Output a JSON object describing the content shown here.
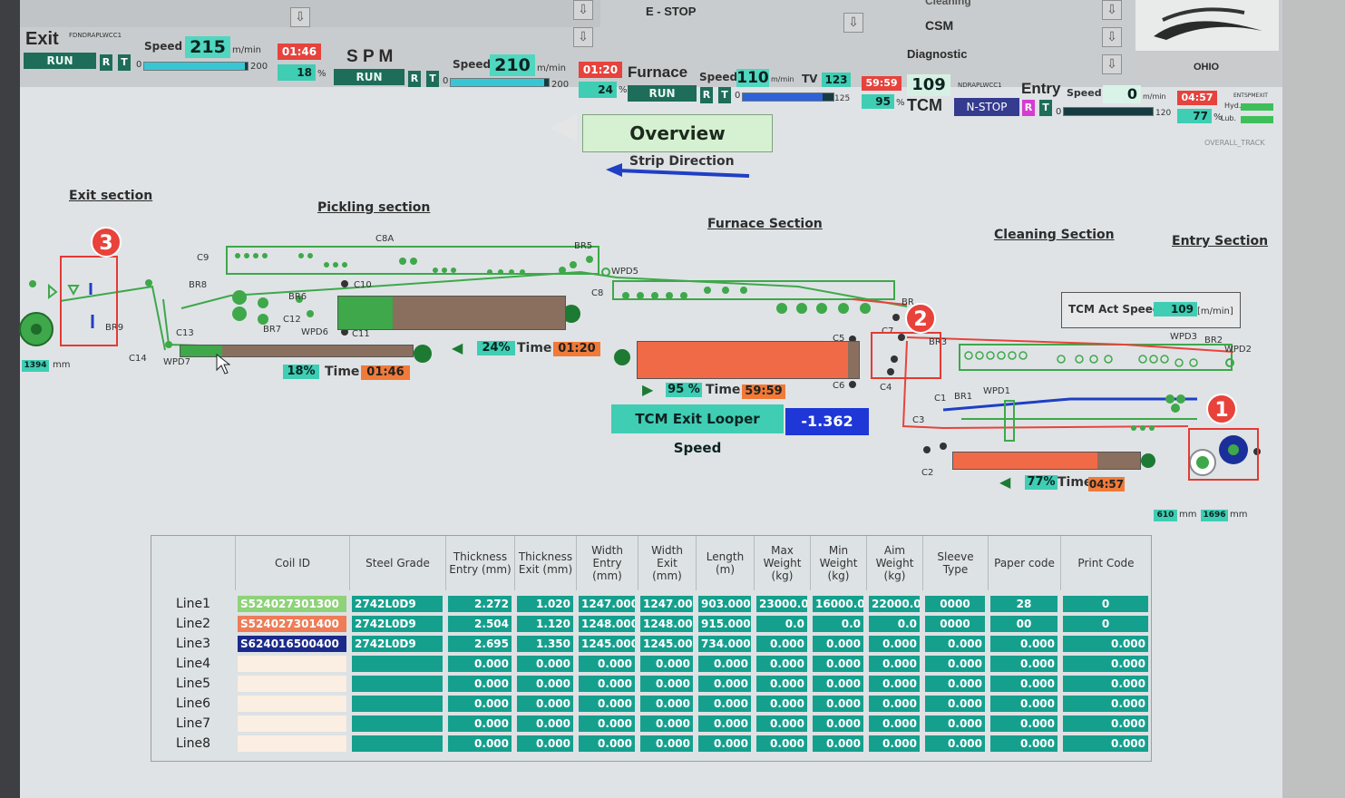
{
  "header": {
    "estop_label": "E - STOP",
    "csm_label": "CSM",
    "diagnostic_label": "Diagnostic",
    "cleaning_label": "Cleaning",
    "logo_text": "OHIO"
  },
  "processes": {
    "exit": {
      "name": "Exit",
      "code": "FDNDRAPLWCC1",
      "speed_label": "Speed",
      "speed": "215",
      "unit": "m/min",
      "status": "RUN",
      "r": "R",
      "t": "T",
      "bar_min": "0",
      "bar_max": "200",
      "bar_pct": 0.97,
      "time": "01:46",
      "pct": "18",
      "pct_sign": "%"
    },
    "spm": {
      "name": "S P M",
      "speed_label": "Speed",
      "speed": "210",
      "unit": "m/min",
      "status": "RUN",
      "r": "R",
      "t": "T",
      "bar_min": "0",
      "bar_max": "200",
      "bar_pct": 0.95,
      "time": "01:20",
      "pct": "24",
      "pct_sign": "%"
    },
    "furnace": {
      "name": "Furnace",
      "speed_label": "Speed",
      "speed": "110",
      "unit": "m/min",
      "tv_label": "TV",
      "tv": "123",
      "status": "RUN",
      "r": "R",
      "t": "T",
      "bar_min": "0",
      "bar_max": "125",
      "bar_pct": 0.88,
      "time": "59:59",
      "pct": "95",
      "pct_sign": "%"
    },
    "tcm": {
      "name": "TCM",
      "speed": "109",
      "code": "NDRAPLWCC1",
      "status": "N-STOP",
      "r": "R",
      "t": "T"
    },
    "entry": {
      "name": "Entry",
      "speed_label": "Speed",
      "speed": "0",
      "unit": "m/min",
      "bar_min": "0",
      "bar_max": "120",
      "bar_pct": 0.0,
      "time": "04:57",
      "pct": "77",
      "pct_sign": "%",
      "panel_title": "ENTSPMEXIT",
      "hyd": "Hyd.",
      "lub": "Lub."
    }
  },
  "overview": {
    "title": "Overview",
    "strip_direction": "Strip Direction",
    "overall_track": "OVERALL_TRACK"
  },
  "sections": {
    "exit": "Exit section",
    "pickling": "Pickling section",
    "furnace": "Furnace Section",
    "cleaning": "Cleaning Section",
    "entry": "Entry Section"
  },
  "equipment": {
    "c9": "C9",
    "c8a": "C8A",
    "br5": "BR5",
    "wpd5": "WPD5",
    "br8": "BR8",
    "c10": "C10",
    "br6": "BR6",
    "c12": "C12",
    "br7": "BR7",
    "wpd6": "WPD6",
    "c11": "C11",
    "c13": "C13",
    "br9": "BR9",
    "c14": "C14",
    "wpd7": "WPD7",
    "c8": "C8",
    "c5": "C5",
    "c6": "C6",
    "c4": "C4",
    "br4": "BR",
    "c7": "C7",
    "br3": "BR3",
    "c1": "C1",
    "br1": "BR1",
    "wpd1": "WPD1",
    "c3": "C3",
    "c2": "C2",
    "wpd3": "WPD3",
    "br2": "BR2",
    "wpd2": "WPD2"
  },
  "loopers": {
    "exit": {
      "pct": "18%",
      "time_label": "Time",
      "time": "01:46",
      "fill": 0.18
    },
    "spm": {
      "pct": "24%",
      "time_label": "Time",
      "time": "01:20",
      "fill": 0.24
    },
    "furnace": {
      "pct": "95 %",
      "time_label": "Time",
      "time": "59:59",
      "fill": 0.95
    },
    "entry": {
      "pct": "77%",
      "time_label": "Time",
      "time": "04:57",
      "fill": 0.77
    }
  },
  "coil_sizes": {
    "exit_coil": "1394",
    "exit_unit": "mm",
    "entry_a": "610",
    "entry_a_unit": "mm",
    "entry_b": "1696",
    "entry_b_unit": "mm"
  },
  "tcm_act": {
    "label": "TCM Act Speed",
    "value": "109",
    "unit": "[m/min]"
  },
  "tcm_exit_looper": {
    "label": "TCM Exit Looper Speed",
    "value": "-1.362"
  },
  "markers": [
    "1",
    "2",
    "3"
  ],
  "table": {
    "headers": [
      "Coil ID",
      "Steel Grade",
      "Thickness Entry (mm)",
      "Thickness Exit (mm)",
      "Width Entry (mm)",
      "Width Exit (mm)",
      "Length (m)",
      "Max Weight (kg)",
      "Min Weight (kg)",
      "Aim Weight (kg)",
      "Sleeve Type",
      "Paper code",
      "Print Code"
    ],
    "rows": [
      {
        "line": "Line1",
        "coil_id": "S524027301300",
        "id_color": "#8ed27a",
        "grade": "2742L0D9",
        "thk_entry": "2.272",
        "thk_exit": "1.020",
        "w_entry": "1247.000",
        "w_exit": "1247.000",
        "length": "903.000",
        "max_w": "23000.0",
        "min_w": "16000.0",
        "aim_w": "22000.0",
        "sleeve": "0000",
        "paper": "28",
        "print": "0"
      },
      {
        "line": "Line2",
        "coil_id": "S524027301400",
        "id_color": "#ee7c57",
        "grade": "2742L0D9",
        "thk_entry": "2.504",
        "thk_exit": "1.120",
        "w_entry": "1248.000",
        "w_exit": "1248.000",
        "length": "915.000",
        "max_w": "0.0",
        "min_w": "0.0",
        "aim_w": "0.0",
        "sleeve": "0000",
        "paper": "00",
        "print": "0"
      },
      {
        "line": "Line3",
        "coil_id": "S624016500400",
        "id_color": "#1b2a8a",
        "grade": "2742L0D9",
        "thk_entry": "2.695",
        "thk_exit": "1.350",
        "w_entry": "1245.000",
        "w_exit": "1245.000",
        "length": "734.000",
        "max_w": "0.000",
        "min_w": "0.000",
        "aim_w": "0.000",
        "sleeve": "0.000",
        "paper": "0.000",
        "print": "0.000"
      },
      {
        "line": "Line4",
        "coil_id": "",
        "id_color": "#fbeee2",
        "grade": "",
        "thk_entry": "0.000",
        "thk_exit": "0.000",
        "w_entry": "0.000",
        "w_exit": "0.000",
        "length": "0.000",
        "max_w": "0.000",
        "min_w": "0.000",
        "aim_w": "0.000",
        "sleeve": "0.000",
        "paper": "0.000",
        "print": "0.000"
      },
      {
        "line": "Line5",
        "coil_id": "",
        "id_color": "#fbeee2",
        "grade": "",
        "thk_entry": "0.000",
        "thk_exit": "0.000",
        "w_entry": "0.000",
        "w_exit": "0.000",
        "length": "0.000",
        "max_w": "0.000",
        "min_w": "0.000",
        "aim_w": "0.000",
        "sleeve": "0.000",
        "paper": "0.000",
        "print": "0.000"
      },
      {
        "line": "Line6",
        "coil_id": "",
        "id_color": "#fbeee2",
        "grade": "",
        "thk_entry": "0.000",
        "thk_exit": "0.000",
        "w_entry": "0.000",
        "w_exit": "0.000",
        "length": "0.000",
        "max_w": "0.000",
        "min_w": "0.000",
        "aim_w": "0.000",
        "sleeve": "0.000",
        "paper": "0.000",
        "print": "0.000"
      },
      {
        "line": "Line7",
        "coil_id": "",
        "id_color": "#fbeee2",
        "grade": "",
        "thk_entry": "0.000",
        "thk_exit": "0.000",
        "w_entry": "0.000",
        "w_exit": "0.000",
        "length": "0.000",
        "max_w": "0.000",
        "min_w": "0.000",
        "aim_w": "0.000",
        "sleeve": "0.000",
        "paper": "0.000",
        "print": "0.000"
      },
      {
        "line": "Line8",
        "coil_id": "",
        "id_color": "#fbeee2",
        "grade": "",
        "thk_entry": "0.000",
        "thk_exit": "0.000",
        "w_entry": "0.000",
        "w_exit": "0.000",
        "length": "0.000",
        "max_w": "0.000",
        "min_w": "0.000",
        "aim_w": "0.000",
        "sleeve": "0.000",
        "paper": "0.000",
        "print": "0.000"
      }
    ]
  },
  "colors": {
    "teal": "#1fa393",
    "green_equipment": "#3ea84a",
    "looper_red": "#f06a47",
    "strip_red": "#e8433b",
    "accent_blue": "#1f3fc4"
  }
}
